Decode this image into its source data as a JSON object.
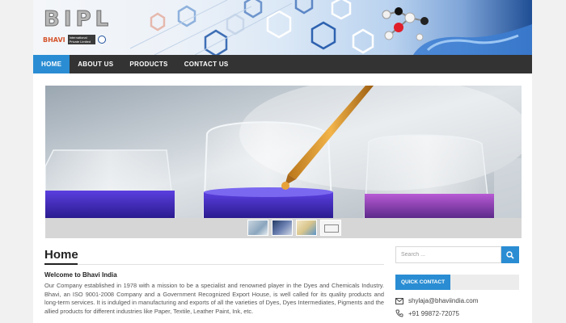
{
  "brand": {
    "logo_letters": "BIPL",
    "logo_name": "BHAVI",
    "logo_tagline": "International Private Limited"
  },
  "nav": {
    "items": [
      {
        "label": "HOME",
        "active": true
      },
      {
        "label": "ABOUT US",
        "active": false
      },
      {
        "label": "PRODUCTS",
        "active": false
      },
      {
        "label": "CONTACT US",
        "active": false
      }
    ]
  },
  "slider": {
    "thumbnail_count": 4,
    "active_thumbnail": 2
  },
  "main": {
    "title": "Home",
    "welcome_heading": "Welcome to Bhavi India",
    "paragraph": "Our Company established in 1978 with a mission to be a specialist and renowned player in the Dyes and Chemicals Industry. Bhavi, an ISO 9001-2008 Company and a Government Recognized Export House, is well called for its quality products and long-term services. It is indulged in manufacturing and exports of all the varieties of Dyes, Dyes Intermediates, Pigments and the allied products for different industries like Paper, Textile, Leather Paint, Ink, etc."
  },
  "sidebar": {
    "search_placeholder": "Search ...",
    "quick_contact_label": "QUICK CONTACT",
    "email": "shylaja@bhaviindia.com",
    "phone": "+91 99872-72075"
  },
  "colors": {
    "accent": "#2a8dd3",
    "nav_bg": "#333333",
    "page_bg": "#f1f1f1"
  },
  "icons": [
    "search-icon",
    "email-icon",
    "phone-icon"
  ]
}
